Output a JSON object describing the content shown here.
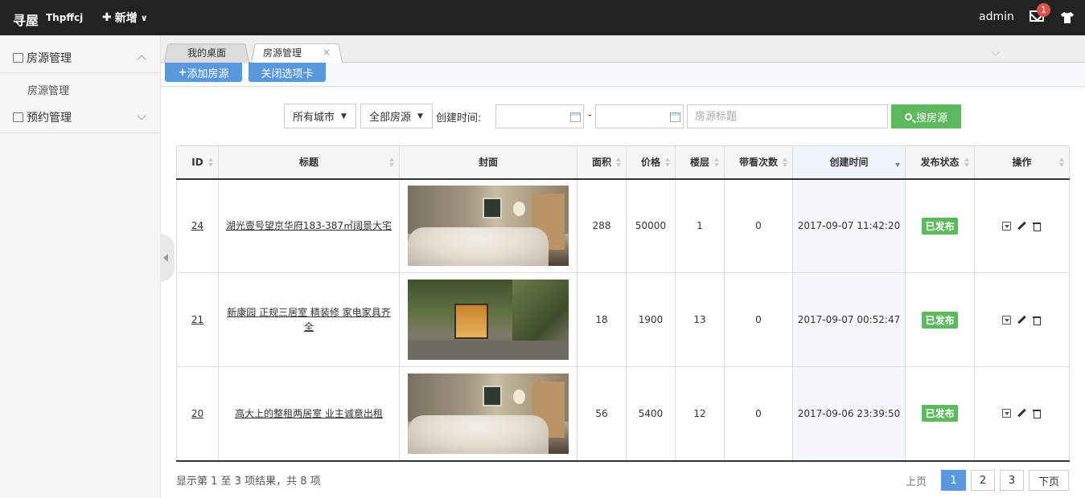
{
  "topbar": {
    "logo": "寻屋",
    "logo_sub": "Thpffcj",
    "new_label": "新增",
    "admin": "admin",
    "mail_count": "1"
  },
  "sidebar": {
    "items": [
      {
        "label": "房源管理",
        "sub": [
          "房源管理"
        ]
      },
      {
        "label": "预约管理"
      }
    ]
  },
  "tabs": [
    {
      "label": "我的桌面"
    },
    {
      "label": "房源管理",
      "close": "×"
    }
  ],
  "toolbar": {
    "add_label": "添加房源",
    "close_tab_label": "关闭选项卡"
  },
  "filters": {
    "city": "所有城市",
    "status": "全部房源",
    "created_label": "创建时间:",
    "date_sep": "-",
    "title_placeholder": "房源标题",
    "search_label": "搜房源"
  },
  "table": {
    "headers": [
      "ID",
      "标题",
      "封面",
      "面积",
      "价格",
      "楼层",
      "带看次数",
      "创建时间",
      "发布状态",
      "操作"
    ],
    "rows": [
      {
        "id": "24",
        "title": "湖光壹号望京华府183-387㎡阔景大宅",
        "cover": "bedroom",
        "area": "288",
        "price": "50000",
        "floor": "1",
        "views": "0",
        "created": "2017-09-07 11:42:20",
        "status": "已发布"
      },
      {
        "id": "21",
        "title": "新康园 正规三居室 精装修 家电家具齐全",
        "cover": "garden",
        "area": "18",
        "price": "1900",
        "floor": "13",
        "views": "0",
        "created": "2017-09-07 00:52:47",
        "status": "已发布"
      },
      {
        "id": "20",
        "title": "高大上的整租两居室 业主诚意出租",
        "cover": "bedroom",
        "area": "56",
        "price": "5400",
        "floor": "12",
        "views": "0",
        "created": "2017-09-06 23:39:50",
        "status": "已发布"
      }
    ]
  },
  "footer": {
    "info": "显示第 1 至 3 项结果，共 8 项",
    "prev": "上页",
    "pages": [
      "1",
      "2",
      "3"
    ],
    "next": "下页"
  }
}
